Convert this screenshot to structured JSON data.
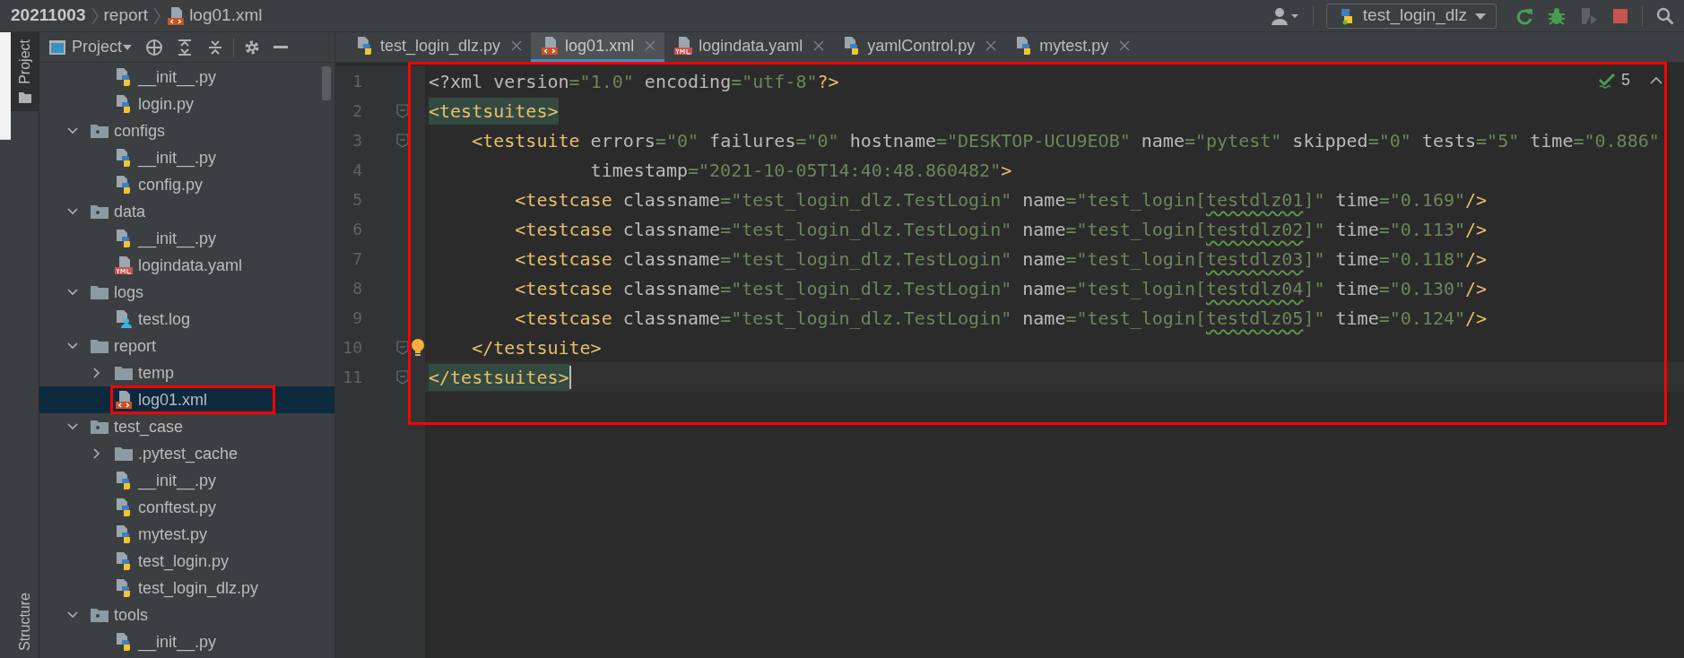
{
  "breadcrumb": [
    {
      "label": "20211003",
      "kind": "root"
    },
    {
      "label": "report",
      "kind": "folder"
    },
    {
      "label": "log01.xml",
      "kind": "xml"
    }
  ],
  "run_config": {
    "label": "test_login_dlz"
  },
  "tool_stripe": {
    "top": [
      {
        "label": "Project",
        "selected": true
      }
    ],
    "bottom": [
      {
        "label": "Structure",
        "selected": false
      }
    ]
  },
  "project_panel": {
    "title": "Project"
  },
  "tree": {
    "continued": [
      {
        "label": "__init__.py",
        "kind": "python",
        "selected": false
      },
      {
        "label": "login.py",
        "kind": "python",
        "selected": false
      }
    ],
    "items": [
      {
        "label": "configs",
        "kind": "package",
        "expanded": true,
        "selected": false,
        "children": [
          {
            "label": "__init__.py",
            "kind": "python",
            "selected": false
          },
          {
            "label": "config.py",
            "kind": "python",
            "selected": false
          }
        ]
      },
      {
        "label": "data",
        "kind": "package",
        "expanded": true,
        "selected": false,
        "children": [
          {
            "label": "__init__.py",
            "kind": "python",
            "selected": false
          },
          {
            "label": "logindata.yaml",
            "kind": "yaml",
            "selected": false
          }
        ]
      },
      {
        "label": "logs",
        "kind": "folder",
        "expanded": true,
        "selected": false,
        "children": [
          {
            "label": "test.log",
            "kind": "log",
            "selected": false
          }
        ]
      },
      {
        "label": "report",
        "kind": "folder",
        "expanded": true,
        "selected": false,
        "children": [
          {
            "label": "temp",
            "kind": "folder",
            "expanded": false,
            "selected": false
          },
          {
            "label": "log01.xml",
            "kind": "xml",
            "selected": true
          }
        ]
      },
      {
        "label": "test_case",
        "kind": "package",
        "expanded": true,
        "selected": false,
        "children": [
          {
            "label": ".pytest_cache",
            "kind": "folder",
            "expanded": false,
            "selected": false
          },
          {
            "label": "__init__.py",
            "kind": "python",
            "selected": false
          },
          {
            "label": "conftest.py",
            "kind": "python",
            "selected": false
          },
          {
            "label": "mytest.py",
            "kind": "python",
            "selected": false
          },
          {
            "label": "test_login.py",
            "kind": "python",
            "selected": false
          },
          {
            "label": "test_login_dlz.py",
            "kind": "python",
            "selected": false
          }
        ]
      },
      {
        "label": "tools",
        "kind": "package",
        "expanded": true,
        "selected": false,
        "children": [
          {
            "label": "__init__.py",
            "kind": "python",
            "selected": false
          }
        ]
      }
    ]
  },
  "tabs": [
    {
      "label": "test_login_dlz.py",
      "kind": "python",
      "selected": false
    },
    {
      "label": "log01.xml",
      "kind": "xml",
      "selected": true
    },
    {
      "label": "logindata.yaml",
      "kind": "yaml",
      "selected": false
    },
    {
      "label": "yamlControl.py",
      "kind": "python",
      "selected": false
    },
    {
      "label": "mytest.py",
      "kind": "python",
      "selected": false
    }
  ],
  "inspection_count": "5",
  "lines": [
    {
      "number": "1",
      "fold": false,
      "bulb": false,
      "highlighted": false,
      "current": false,
      "tokens": [
        {
          "kind": "attr",
          "text": "<?xml version"
        },
        {
          "kind": "value",
          "text": "=\"1.0\""
        },
        {
          "kind": "attr",
          "text": " encoding"
        },
        {
          "kind": "value",
          "text": "=\"utf-8\""
        },
        {
          "kind": "tag",
          "text": "?>"
        }
      ]
    },
    {
      "number": "2",
      "fold": true,
      "bulb": false,
      "highlighted": true,
      "current": false,
      "tokens": [
        {
          "kind": "tag",
          "text": "<testsuites>"
        }
      ]
    },
    {
      "number": "3",
      "fold": true,
      "bulb": false,
      "highlighted": false,
      "current": false,
      "tokens": [
        {
          "kind": "tag",
          "text": "    <testsuite"
        },
        {
          "kind": "attr",
          "text": " errors"
        },
        {
          "kind": "value",
          "text": "=\"0\""
        },
        {
          "kind": "attr",
          "text": " failures"
        },
        {
          "kind": "value",
          "text": "=\"0\""
        },
        {
          "kind": "attr",
          "text": " hostname"
        },
        {
          "kind": "value",
          "text": "=\"DESKTOP-UCU9EOB\""
        },
        {
          "kind": "attr",
          "text": " name"
        },
        {
          "kind": "value",
          "text": "=\"pytest\""
        },
        {
          "kind": "attr",
          "text": " skipped"
        },
        {
          "kind": "value",
          "text": "=\"0\""
        },
        {
          "kind": "attr",
          "text": " tests"
        },
        {
          "kind": "value",
          "text": "=\"5\""
        },
        {
          "kind": "attr",
          "text": " time"
        },
        {
          "kind": "value",
          "text": "=\"0.886\""
        }
      ]
    },
    {
      "number": "4",
      "fold": false,
      "bulb": false,
      "highlighted": false,
      "current": false,
      "tokens": [
        {
          "kind": "attr",
          "text": "               timestamp"
        },
        {
          "kind": "value",
          "text": "=\"2021-10-05T14:40:48.860482\""
        },
        {
          "kind": "tag",
          "text": ">"
        }
      ]
    },
    {
      "number": "5",
      "fold": false,
      "bulb": false,
      "highlighted": false,
      "current": false,
      "tokens": [
        {
          "kind": "tag",
          "text": "        <testcase"
        },
        {
          "kind": "attr",
          "text": " classname"
        },
        {
          "kind": "value",
          "text": "=\"test_login_dlz.TestLogin\""
        },
        {
          "kind": "attr",
          "text": " name"
        },
        {
          "kind": "value",
          "text": "=\"test_login["
        },
        {
          "kind": "typo",
          "text": "testdlz01"
        },
        {
          "kind": "value",
          "text": "]\""
        },
        {
          "kind": "attr",
          "text": " time"
        },
        {
          "kind": "value",
          "text": "=\"0.169\""
        },
        {
          "kind": "tag",
          "text": "/>"
        }
      ]
    },
    {
      "number": "6",
      "fold": false,
      "bulb": false,
      "highlighted": false,
      "current": false,
      "tokens": [
        {
          "kind": "tag",
          "text": "        <testcase"
        },
        {
          "kind": "attr",
          "text": " classname"
        },
        {
          "kind": "value",
          "text": "=\"test_login_dlz.TestLogin\""
        },
        {
          "kind": "attr",
          "text": " name"
        },
        {
          "kind": "value",
          "text": "=\"test_login["
        },
        {
          "kind": "typo",
          "text": "testdlz02"
        },
        {
          "kind": "value",
          "text": "]\""
        },
        {
          "kind": "attr",
          "text": " time"
        },
        {
          "kind": "value",
          "text": "=\"0.113\""
        },
        {
          "kind": "tag",
          "text": "/>"
        }
      ]
    },
    {
      "number": "7",
      "fold": false,
      "bulb": false,
      "highlighted": false,
      "current": false,
      "tokens": [
        {
          "kind": "tag",
          "text": "        <testcase"
        },
        {
          "kind": "attr",
          "text": " classname"
        },
        {
          "kind": "value",
          "text": "=\"test_login_dlz.TestLogin\""
        },
        {
          "kind": "attr",
          "text": " name"
        },
        {
          "kind": "value",
          "text": "=\"test_login["
        },
        {
          "kind": "typo",
          "text": "testdlz03"
        },
        {
          "kind": "value",
          "text": "]\""
        },
        {
          "kind": "attr",
          "text": " time"
        },
        {
          "kind": "value",
          "text": "=\"0.118\""
        },
        {
          "kind": "tag",
          "text": "/>"
        }
      ]
    },
    {
      "number": "8",
      "fold": false,
      "bulb": false,
      "highlighted": false,
      "current": false,
      "tokens": [
        {
          "kind": "tag",
          "text": "        <testcase"
        },
        {
          "kind": "attr",
          "text": " classname"
        },
        {
          "kind": "value",
          "text": "=\"test_login_dlz.TestLogin\""
        },
        {
          "kind": "attr",
          "text": " name"
        },
        {
          "kind": "value",
          "text": "=\"test_login["
        },
        {
          "kind": "typo",
          "text": "testdlz04"
        },
        {
          "kind": "value",
          "text": "]\""
        },
        {
          "kind": "attr",
          "text": " time"
        },
        {
          "kind": "value",
          "text": "=\"0.130\""
        },
        {
          "kind": "tag",
          "text": "/>"
        }
      ]
    },
    {
      "number": "9",
      "fold": false,
      "bulb": false,
      "highlighted": false,
      "current": false,
      "tokens": [
        {
          "kind": "tag",
          "text": "        <testcase"
        },
        {
          "kind": "attr",
          "text": " classname"
        },
        {
          "kind": "value",
          "text": "=\"test_login_dlz.TestLogin\""
        },
        {
          "kind": "attr",
          "text": " name"
        },
        {
          "kind": "value",
          "text": "=\"test_login["
        },
        {
          "kind": "typo",
          "text": "testdlz05"
        },
        {
          "kind": "value",
          "text": "]\""
        },
        {
          "kind": "attr",
          "text": " time"
        },
        {
          "kind": "value",
          "text": "=\"0.124\""
        },
        {
          "kind": "tag",
          "text": "/>"
        }
      ]
    },
    {
      "number": "10",
      "fold": true,
      "bulb": true,
      "highlighted": false,
      "current": false,
      "tokens": [
        {
          "kind": "tag",
          "text": "    </testsuite>"
        }
      ]
    },
    {
      "number": "11",
      "fold": true,
      "bulb": false,
      "highlighted": true,
      "current": true,
      "tokens": [
        {
          "kind": "tag",
          "text": "</testsuites>"
        }
      ]
    }
  ]
}
